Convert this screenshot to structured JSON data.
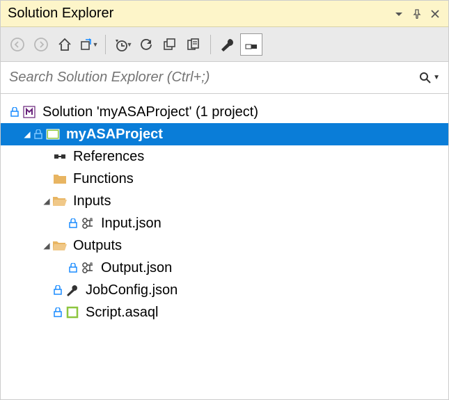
{
  "panel": {
    "title": "Solution Explorer"
  },
  "search": {
    "placeholder": "Search Solution Explorer (Ctrl+;)"
  },
  "tree": {
    "solution": "Solution 'myASAProject' (1 project)",
    "project": "myASAProject",
    "references": "References",
    "functions": "Functions",
    "inputs": "Inputs",
    "input_json": "Input.json",
    "outputs": "Outputs",
    "output_json": "Output.json",
    "jobconfig": "JobConfig.json",
    "script": "Script.asaql"
  }
}
